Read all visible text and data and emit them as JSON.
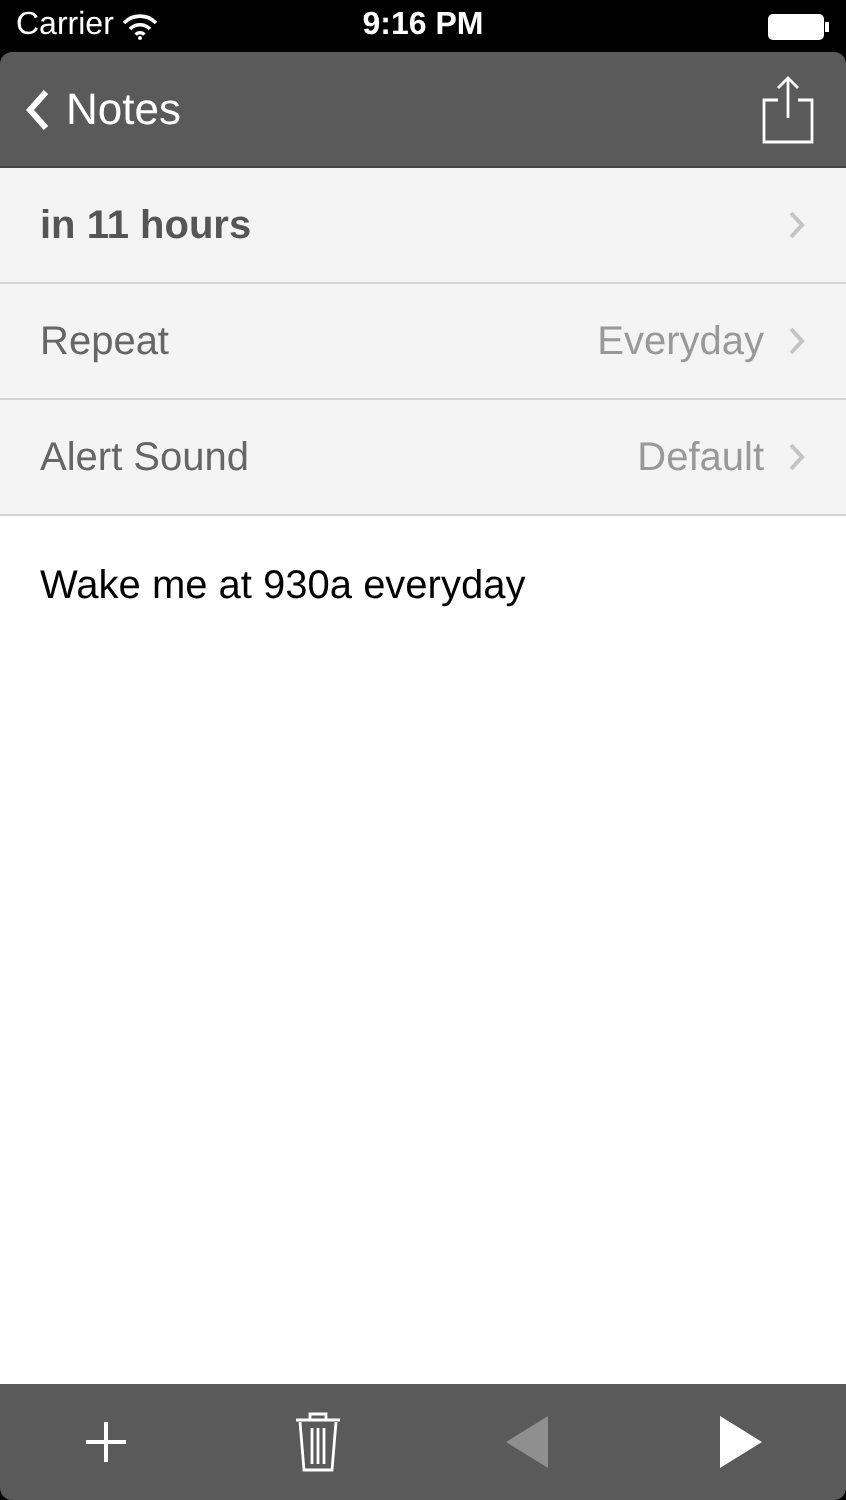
{
  "status_bar": {
    "carrier": "Carrier",
    "time": "9:16 PM"
  },
  "nav_bar": {
    "back_label": "Notes"
  },
  "rows": [
    {
      "kind": "heading",
      "label": "in 11 hours"
    },
    {
      "kind": "setting",
      "label": "Repeat",
      "value": "Everyday"
    },
    {
      "kind": "setting",
      "label": "Alert Sound",
      "value": "Default"
    }
  ],
  "note": {
    "text": "Wake me at 930a everyday"
  },
  "toolbar": [
    {
      "kind": "add",
      "disabled": false
    },
    {
      "kind": "trash",
      "disabled": false
    },
    {
      "kind": "previous",
      "disabled": true
    },
    {
      "kind": "next",
      "disabled": false
    }
  ]
}
